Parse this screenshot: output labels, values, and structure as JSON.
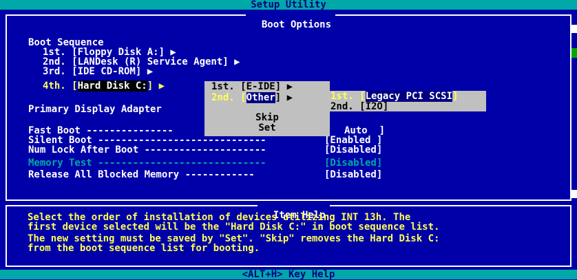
{
  "header": {
    "title": "Setup Utility"
  },
  "main": {
    "panel_title": "Boot Options",
    "boot_sequence_label": "Boot Sequence",
    "boot_items": [
      "1st. [Floppy Disk A:] ▶",
      "2nd. [LANDesk (R) Service Agent] ▶",
      "3rd. [IDE CD-ROM] ▶"
    ],
    "boot_4th_prefix": "4th. [",
    "boot_4th_value": "Hard Disk C:",
    "boot_4th_suffix": "] ▶",
    "primary_display_label": "Primary Display Adapter",
    "settings": [
      {
        "label": "Fast Boot ---------------",
        "value": "Auto  ]"
      },
      {
        "label": "Silent Boot -----------------------------",
        "value": "[Enabled ]"
      },
      {
        "label": "Num Lock After Boot ---------------------",
        "value": "[Disabled]"
      },
      {
        "label": "Memory Test -----------------------------",
        "value": "[Disabled]"
      },
      {
        "label": "Release All Blocked Memory ------------",
        "value": "[Disabled]"
      }
    ]
  },
  "popup": {
    "item1": "1st. [E-IDE] ▶",
    "item2_prefix": "2nd. [",
    "item2_value": "Other",
    "item2_suffix": "] ▶",
    "skip": "Skip",
    "set": "Set",
    "sub_item1_prefix": "1st. [",
    "sub_item1_value": "Legacy PCI SCSI",
    "sub_item1_suffix": "]",
    "sub_item2": "2nd. [I2O]"
  },
  "help": {
    "title": "Item Help",
    "lines": [
      "Select the order of installation of devices utilizing INT 13h. The",
      "first device selected will be the \"Hard Disk C:\" in boot sequence list.",
      "The new setting must be saved by \"Set\". \"Skip\" removes the Hard Disk C:",
      "from the boot sequence list for booting."
    ]
  },
  "footer": {
    "text": "<ALT+H>  Key Help"
  }
}
